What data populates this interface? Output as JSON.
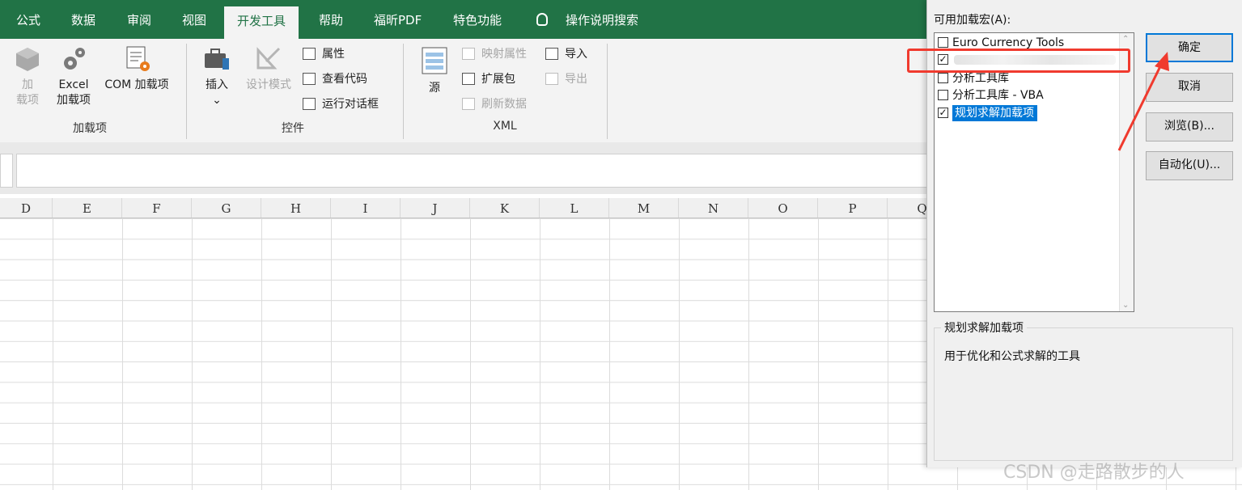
{
  "ribbon_tabs": [
    {
      "label": "公式"
    },
    {
      "label": "数据"
    },
    {
      "label": "审阅"
    },
    {
      "label": "视图"
    },
    {
      "label": "开发工具",
      "active": true
    },
    {
      "label": "帮助"
    },
    {
      "label": "福昕PDF"
    },
    {
      "label": "特色功能"
    }
  ],
  "tell_me": "操作说明搜索",
  "groups": {
    "addins": {
      "label": "加载项",
      "addins_btn_line1": "加",
      "addins_btn_line2": "载项",
      "excel_line1": "Excel",
      "excel_line2": "加载项",
      "com_label": "COM 加载项"
    },
    "controls": {
      "label": "控件",
      "insert": "插入",
      "insert_arrow": "⌄",
      "design_mode": "设计模式",
      "properties": "属性",
      "view_code": "查看代码",
      "run_dialog": "运行对话框"
    },
    "xml": {
      "label": "XML",
      "source": "源",
      "map_properties": "映射属性",
      "expansion_packs": "扩展包",
      "refresh_data": "刷新数据",
      "import": "导入",
      "export": "导出"
    }
  },
  "columns": [
    "D",
    "E",
    "F",
    "G",
    "H",
    "I",
    "J",
    "K",
    "L",
    "M",
    "N",
    "O",
    "P",
    "Q"
  ],
  "dialog": {
    "title": "可用加载宏(A):",
    "items": [
      {
        "label": "Euro Currency Tools",
        "checked": false
      },
      {
        "label": "",
        "checked": true
      },
      {
        "label": "分析工具库",
        "checked": false
      },
      {
        "label": "分析工具库 - VBA",
        "checked": false
      },
      {
        "label": "规划求解加载项",
        "checked": true,
        "selected": true
      }
    ],
    "ok": "确定",
    "cancel": "取消",
    "browse": "浏览(B)...",
    "automation": "自动化(U)...",
    "desc_title": "规划求解加载项",
    "desc_text": "用于优化和公式求解的工具"
  },
  "check_mark": "✓",
  "scroll_up": "⌃",
  "scroll_down": "⌄",
  "watermark": "CSDN @走路散步的人",
  "colors": {
    "excel_green": "#217346",
    "selection_blue": "#0078d7",
    "highlight_red": "#f03a2e"
  }
}
